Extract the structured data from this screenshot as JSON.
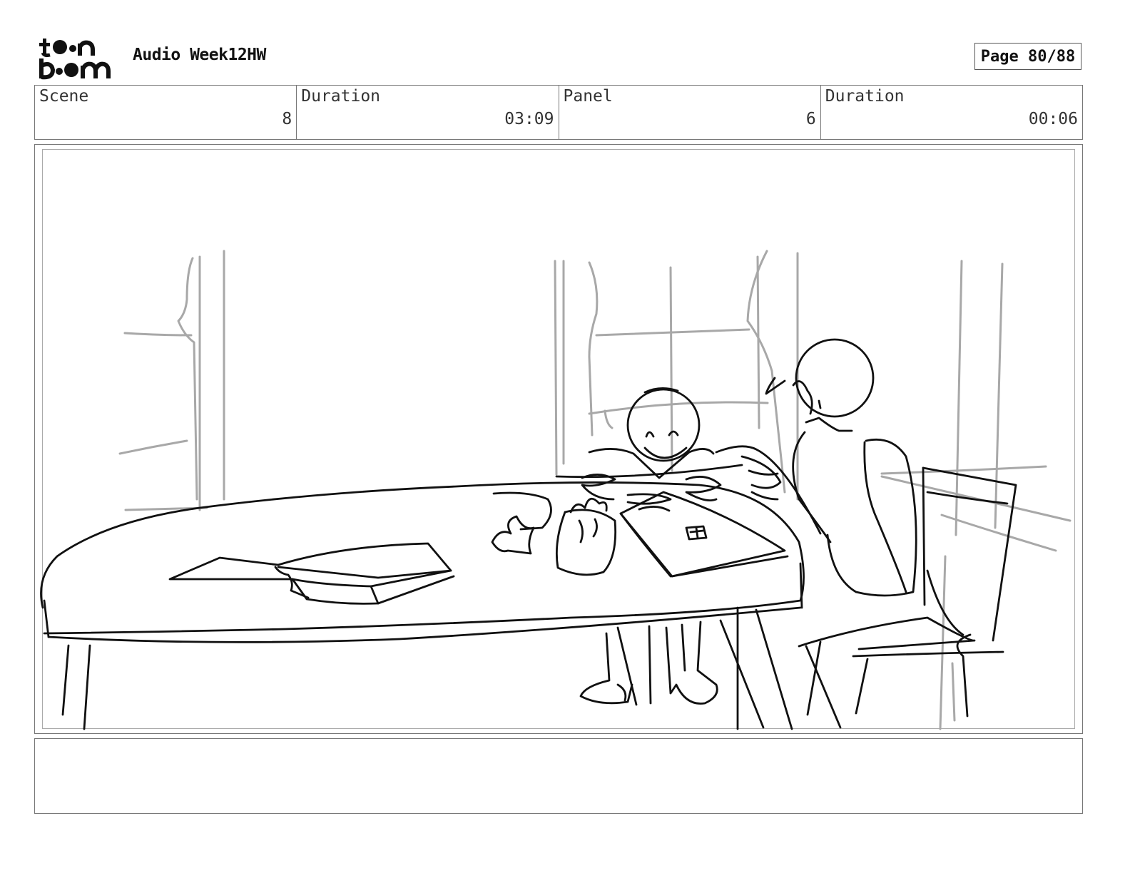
{
  "header": {
    "logo_text": "toon boom",
    "doc_title": "Audio Week12HW",
    "page_indicator": "Page 80/88"
  },
  "info": {
    "scene_label": "Scene",
    "scene_value": "8",
    "scene_duration_label": "Duration",
    "scene_duration_value": "03:09",
    "panel_label": "Panel",
    "panel_value": "6",
    "panel_duration_label": "Duration",
    "panel_duration_value": "00:06"
  },
  "notes": {
    "text": ""
  }
}
